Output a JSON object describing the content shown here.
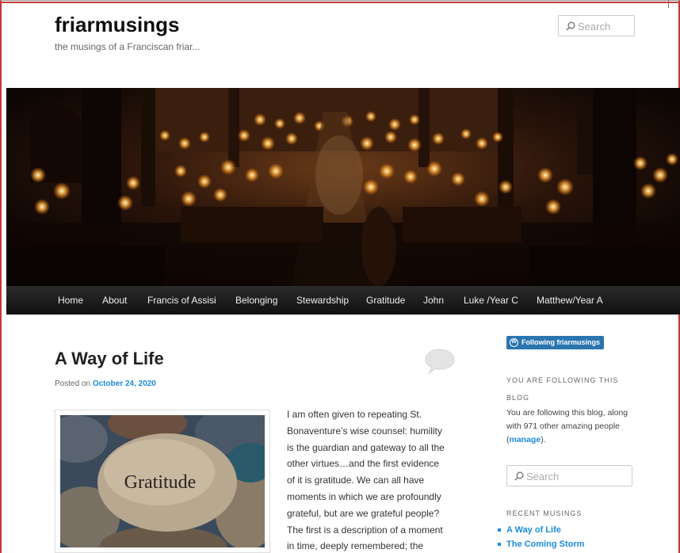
{
  "site": {
    "title": "friarmusings",
    "description": "the musings of a Franciscan friar...",
    "search_placeholder": "Search"
  },
  "nav": {
    "items": [
      "Home",
      "About",
      "Francis of Assisi",
      "Belonging",
      "Stewardship",
      "Gratitude",
      "John",
      "Luke /Year C",
      "Matthew/Year A"
    ]
  },
  "post": {
    "title": "A Way of Life",
    "posted_prefix": "Posted on",
    "date": "October 24, 2020",
    "image_caption": "Gratitude",
    "body_lines": [
      "I am often given to repeating St.",
      "Bonaventure’s wise counsel: humility",
      "is the guardian and gateway to all the",
      "other virtues…and the first evidence",
      "of it is gratitude. We can all have",
      "moments in which we are profoundly",
      "grateful, but are we grateful people?",
      "The first is a description of a moment",
      "in time, deeply remembered; the"
    ]
  },
  "sidebar": {
    "follow_badge": "Following friarmusings",
    "following_heading_line1": "YOU ARE FOLLOWING THIS",
    "following_heading_line2": "BLOG",
    "following_text_before": "You are following this blog, along with 971 other amazing people (",
    "manage_link": "manage",
    "following_text_after": ").",
    "search_placeholder": "Search",
    "recent_heading": "RECENT MUSINGS",
    "recent_items": [
      "A Way of Life",
      "The Coming Storm"
    ]
  },
  "colors": {
    "accent_link": "#1b8be0",
    "frame_red": "#c43838",
    "nav_bg": "#1c1c1c",
    "badge_blue": "#2a75b0"
  },
  "icons": {
    "search": "search-icon",
    "comment": "comment-bubble-icon",
    "wordpress": "wordpress-icon"
  }
}
